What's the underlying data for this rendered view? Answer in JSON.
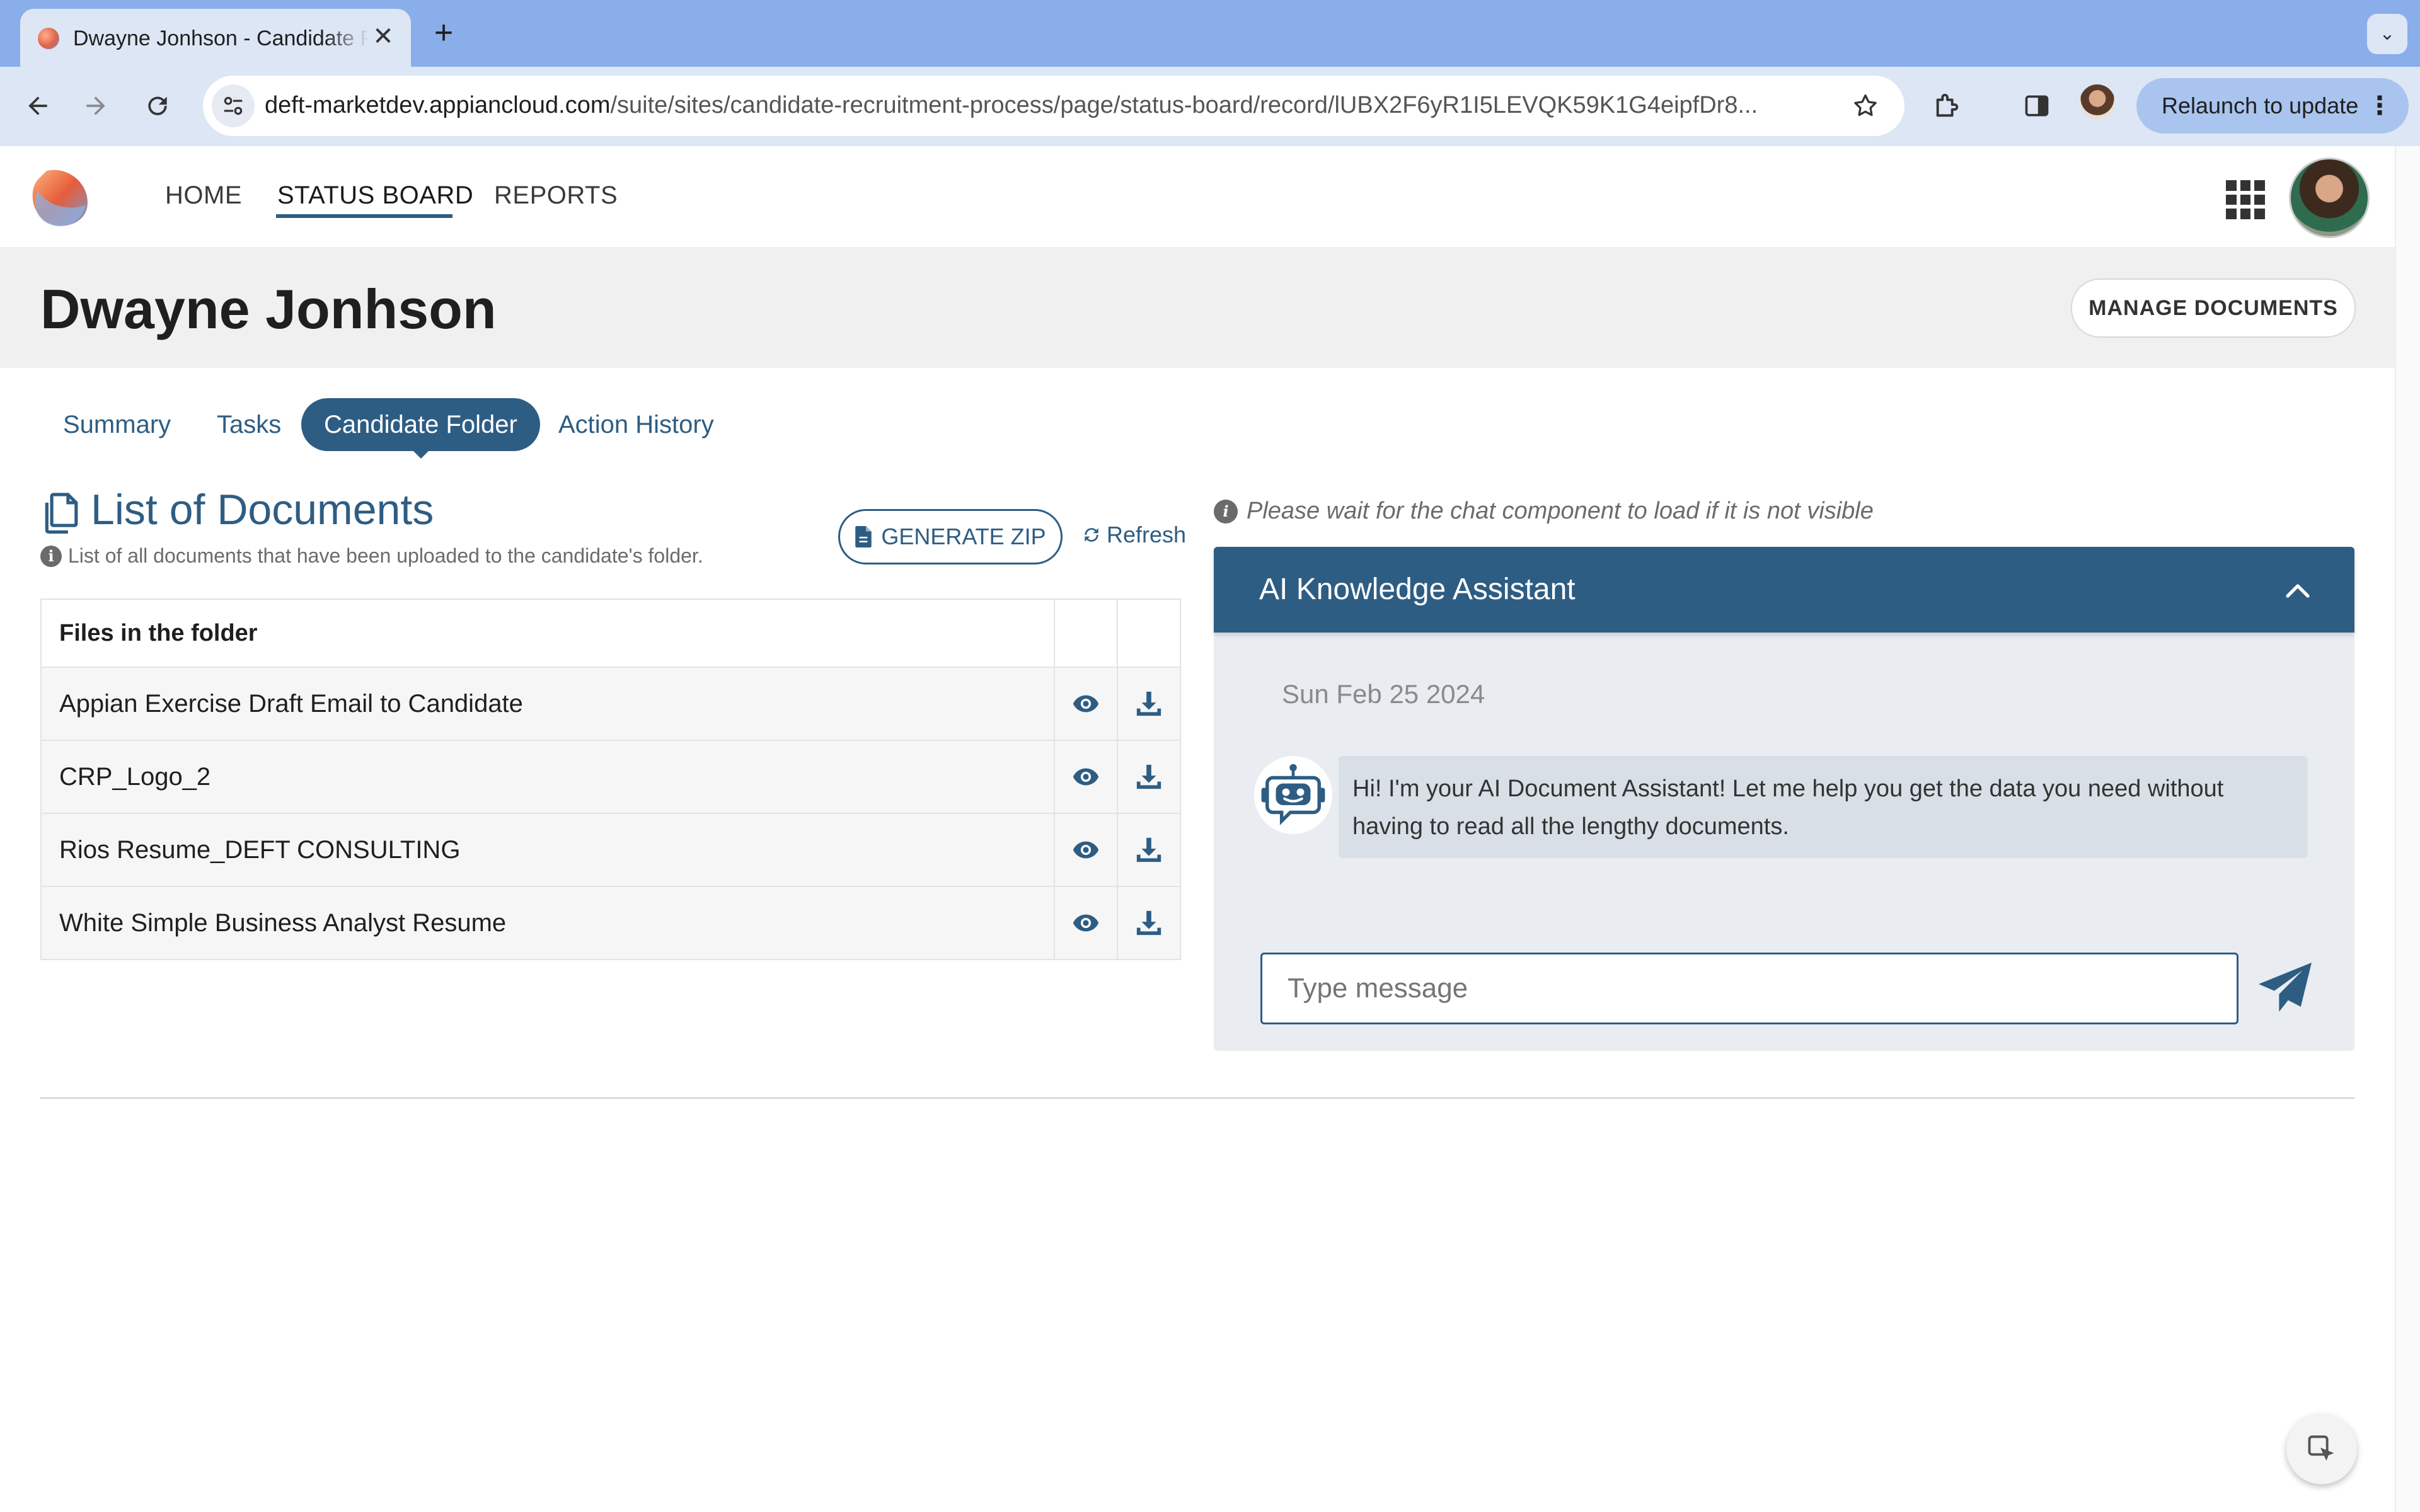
{
  "browser": {
    "tab_title": "Dwayne Jonhson - Candidate Folder",
    "close_glyph": "✕",
    "newtab_glyph": "+",
    "url_host": "deft-marketdev.appiancloud.com",
    "url_path": "/suite/sites/candidate-recruitment-process/page/status-board/record/lUBX2F6yR1I5LEVQK59K1G4eipfDr8...",
    "relaunch_label": "Relaunch to update",
    "menu_glyph": "⋮",
    "tabsearch_glyph": "⌄"
  },
  "nav": {
    "items": [
      {
        "label": "HOME",
        "active": false
      },
      {
        "label": "STATUS BOARD",
        "active": true
      },
      {
        "label": "REPORTS",
        "active": false
      }
    ]
  },
  "record": {
    "title": "Dwayne Jonhson",
    "manage_documents_label": "MANAGE DOCUMENTS"
  },
  "tabs": [
    {
      "label": "Summary",
      "active": false
    },
    {
      "label": "Tasks",
      "active": false
    },
    {
      "label": "Candidate Folder",
      "active": true
    },
    {
      "label": "Action History",
      "active": false
    }
  ],
  "documents": {
    "title": "List of Documents",
    "subtitle": "List of all documents that have been uploaded to the candidate's folder.",
    "generate_zip_label": "GENERATE ZIP",
    "refresh_label": "Refresh",
    "table_header": "Files in the folder",
    "files": [
      "Appian Exercise Draft Email to Candidate",
      "CRP_Logo_2",
      "Rios Resume_DEFT CONSULTING",
      "White Simple Business Analyst Resume"
    ]
  },
  "chat": {
    "note": "Please wait for the chat component to load if it is not visible",
    "title": "AI Knowledge Assistant",
    "date": "Sun Feb 25 2024",
    "bot_message": "Hi! I'm your AI Document Assistant! Let me help you get the data you need without having to read all the lengthy documents.",
    "input_placeholder": "Type message"
  },
  "info_glyph": "i",
  "colors": {
    "accent": "#2e5d83",
    "tabbar": "#8aaee9",
    "toolbar": "#dde6f5",
    "chat_bg": "#e9edf1"
  }
}
